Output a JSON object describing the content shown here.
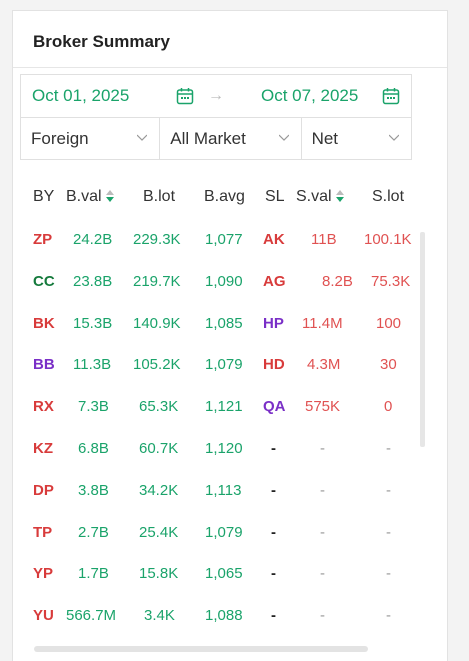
{
  "panel": {
    "title": "Broker Summary"
  },
  "date_range": {
    "from": "Oct 01, 2025",
    "to": "Oct 07, 2025",
    "arrow": "→"
  },
  "filters": [
    {
      "label": "Foreign"
    },
    {
      "label": "All Market"
    },
    {
      "label": "Net"
    }
  ],
  "headers": {
    "by": "BY",
    "bval": "B.val",
    "blot": "B.lot",
    "bavg": "B.avg",
    "sl": "SL",
    "sval": "S.val",
    "slot": "S.lot"
  },
  "colors": {
    "accent": "#1aa36a",
    "sell": "#e05252",
    "red_code": "#d83b3b",
    "green_code": "#157a3c",
    "purple_code": "#7a2fc7"
  },
  "rows": [
    {
      "by": "ZP",
      "by_color": "red",
      "bval": "24.2B",
      "blot": "229.3K",
      "bavg": "1,077",
      "sl": "AK",
      "sl_color": "red",
      "sval": "11B",
      "slot": "100.1K"
    },
    {
      "by": "CC",
      "by_color": "green",
      "bval": "23.8B",
      "blot": "219.7K",
      "bavg": "1,090",
      "sl": "AG",
      "sl_color": "red",
      "sval": "8.2B",
      "slot": "75.3K"
    },
    {
      "by": "BK",
      "by_color": "red",
      "bval": "15.3B",
      "blot": "140.9K",
      "bavg": "1,085",
      "sl": "HP",
      "sl_color": "purple",
      "sval": "11.4M",
      "slot": "100"
    },
    {
      "by": "BB",
      "by_color": "purple",
      "bval": "11.3B",
      "blot": "105.2K",
      "bavg": "1,079",
      "sl": "HD",
      "sl_color": "red",
      "sval": "4.3M",
      "slot": "30"
    },
    {
      "by": "RX",
      "by_color": "red",
      "bval": "7.3B",
      "blot": "65.3K",
      "bavg": "1,121",
      "sl": "QA",
      "sl_color": "purple",
      "sval": "575K",
      "slot": "0"
    },
    {
      "by": "KZ",
      "by_color": "red",
      "bval": "6.8B",
      "blot": "60.7K",
      "bavg": "1,120",
      "sl": "-",
      "sl_color": "black",
      "sval": "-",
      "slot": "-"
    },
    {
      "by": "DP",
      "by_color": "red",
      "bval": "3.8B",
      "blot": "34.2K",
      "bavg": "1,113",
      "sl": "-",
      "sl_color": "black",
      "sval": "-",
      "slot": "-"
    },
    {
      "by": "TP",
      "by_color": "red",
      "bval": "2.7B",
      "blot": "25.4K",
      "bavg": "1,079",
      "sl": "-",
      "sl_color": "black",
      "sval": "-",
      "slot": "-"
    },
    {
      "by": "YP",
      "by_color": "red",
      "bval": "1.7B",
      "blot": "15.8K",
      "bavg": "1,065",
      "sl": "-",
      "sl_color": "black",
      "sval": "-",
      "slot": "-"
    },
    {
      "by": "YU",
      "by_color": "red",
      "bval": "566.7M",
      "blot": "3.4K",
      "bavg": "1,088",
      "sl": "-",
      "sl_color": "black",
      "sval": "-",
      "slot": "-"
    }
  ]
}
